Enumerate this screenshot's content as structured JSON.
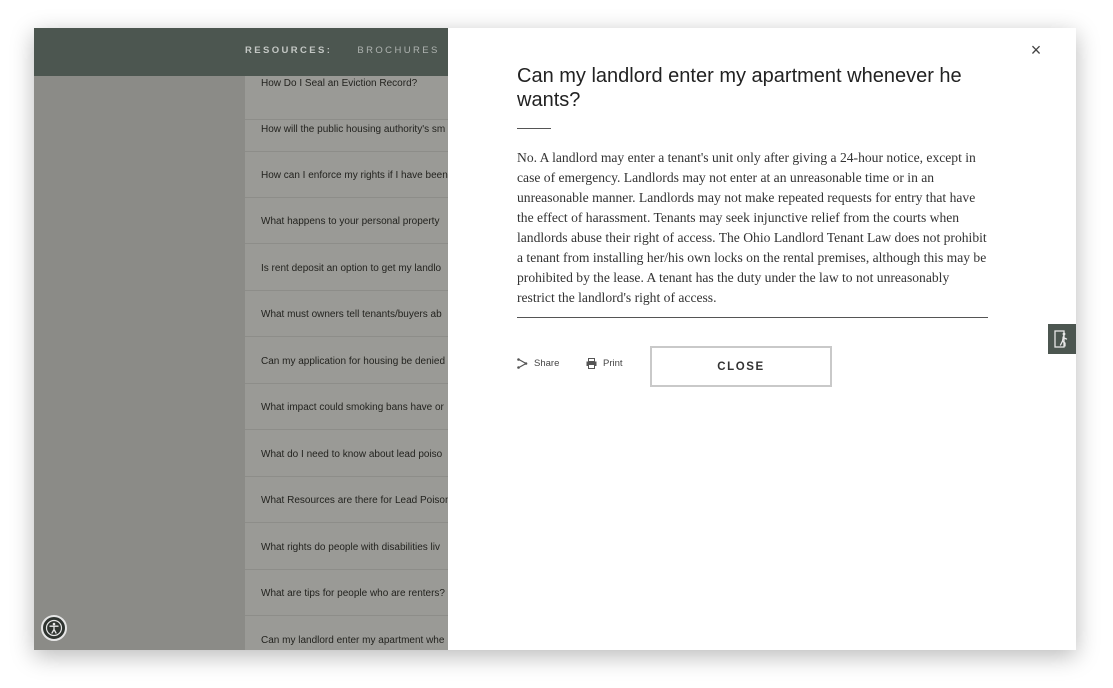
{
  "nav": {
    "resources_label": "RESOURCES:",
    "brochures_label": "BROCHURES"
  },
  "faq_list": [
    "How Do I Seal an Eviction Record?",
    "How will the public housing authority's sm",
    "How can I enforce my rights if I have been",
    "What happens to your personal property",
    "Is rent deposit an option to get my landlo",
    "What must owners tell tenants/buyers ab",
    "Can my application for housing be denied",
    "What impact could smoking bans have or",
    "What do I need to know about lead poiso",
    "What Resources are there for Lead Poison",
    "What rights do people with disabilities liv",
    "What are tips for people who are renters?",
    "Can my landlord enter my apartment whe"
  ],
  "modal": {
    "close_glyph": "×",
    "title": "Can my landlord enter my apartment whenever he wants?",
    "body": "No. A landlord may enter a tenant's unit only after giving a 24-hour notice, except in case of emergency. Landlords may not enter at an unreasonable time or in an unreasonable manner. Landlords may not make repeated requests for entry that have the effect of harassment. Tenants may seek injunctive relief from the courts when landlords abuse their right of access. The Ohio Landlord Tenant Law does not prohibit a tenant from installing her/his own locks on the rental premises, although this may be prohibited by the lease. A tenant has the duty under the law to not unreasonably restrict the landlord's right of access.",
    "share_label": "Share",
    "print_label": "Print",
    "close_label": "CLOSE"
  },
  "icons": {
    "accessibility": "accessibility-icon",
    "share": "share-icon",
    "print": "print-icon",
    "exit": "quick-exit-icon"
  },
  "colors": {
    "header": "#4c5650",
    "overlay": "#8b8b87",
    "panel": "#ffffff"
  }
}
